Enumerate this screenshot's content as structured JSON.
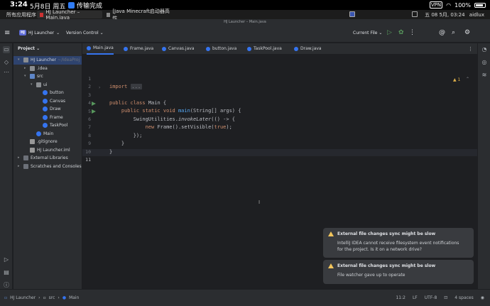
{
  "statusbar": {
    "time": "3:24",
    "date": "5月8日 周五",
    "message": "传输完成",
    "vpn": "VPN",
    "battery": "100%"
  },
  "desktop": {
    "apps_label": "所有应用程序",
    "windows": [
      {
        "title": "HJ Launcher – Main.java"
      },
      {
        "title": "[Java Minecraft启动器高性..."
      }
    ],
    "clock": "五 08 5月, 03:24",
    "user": "aidlux"
  },
  "ide": {
    "window_title": "HJ Launcher – Main.java",
    "toolbar": {
      "project_badge": "HJ",
      "project_name": "HJ Launcher",
      "vcs": "Version Control",
      "run_config": "Current File"
    },
    "project_panel": {
      "header": "Project",
      "tree": [
        {
          "label": "HJ Launcher",
          "hint": "~/IdeaProj",
          "type": "folder",
          "depth": 0,
          "arrow": "▾",
          "selected": true
        },
        {
          "label": ".idea",
          "type": "folder",
          "depth": 1,
          "arrow": "▸"
        },
        {
          "label": "src",
          "type": "srcfolder",
          "depth": 1,
          "arrow": "▾"
        },
        {
          "label": "ui",
          "type": "folder",
          "depth": 2,
          "arrow": "▾"
        },
        {
          "label": "button",
          "type": "cls",
          "depth": 3
        },
        {
          "label": "Canvas",
          "type": "cls",
          "depth": 3
        },
        {
          "label": "Draw",
          "type": "cls",
          "depth": 3
        },
        {
          "label": "Frame",
          "type": "cls",
          "depth": 3
        },
        {
          "label": "TaskPool",
          "type": "cls",
          "depth": 3
        },
        {
          "label": "Main",
          "type": "cls",
          "depth": 2
        },
        {
          "label": ".gitignore",
          "type": "file",
          "depth": 1
        },
        {
          "label": "HJ Launcher.iml",
          "type": "file",
          "depth": 1
        },
        {
          "label": "External Libraries",
          "type": "lib",
          "depth": 0,
          "arrow": "▸"
        },
        {
          "label": "Scratches and Consoles",
          "type": "lib",
          "depth": 0,
          "arrow": "▸"
        }
      ]
    },
    "tabs": [
      "Main.java",
      "Frame.java",
      "Canvas.java",
      "button.java",
      "TaskPool.java",
      "Draw.java"
    ],
    "active_tab": 0,
    "editor": {
      "warnings": "1",
      "line_numbers": [
        "1",
        "2",
        "3",
        "4",
        "5",
        "6",
        "7",
        "8",
        "9",
        "10",
        "11"
      ],
      "code": {
        "l2_kw": "import",
        "l2_fold": "...",
        "l4_kw": "public class",
        "l4_name": "Main",
        "l4_rest": "{",
        "l5_kw": "public static void",
        "l5_fn": "main",
        "l5_rest": "(String[] args) {",
        "l6_a": "SwingUtilities.",
        "l6_it": "invokeLater",
        "l6_b": "(() -> {",
        "l7_kw": "new",
        "l7_a": "Frame().setVisible(",
        "l7_kw2": "true",
        "l7_b": ");",
        "l8": "});",
        "l9": "}",
        "l10": "}"
      }
    },
    "notifications": [
      {
        "title": "External file changes sync might be slow",
        "body": "IntelliJ IDEA cannot receive filesystem event notifications for the project. Is it on a network drive?"
      },
      {
        "title": "External file changes sync might be slow",
        "body": "File watcher gave up to operate"
      }
    ],
    "statusline": {
      "breadcrumb": [
        "HJ Launcher",
        "src",
        "Main"
      ],
      "position": "11:2",
      "line_sep": "LF",
      "encoding": "UTF-8",
      "indent": "4 spaces"
    }
  }
}
